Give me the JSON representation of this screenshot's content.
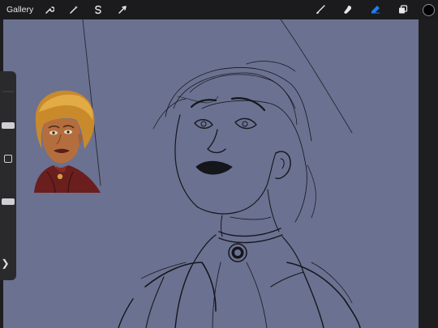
{
  "topbar": {
    "gallery_label": "Gallery",
    "left_tools": [
      {
        "name": "actions",
        "icon": "wrench-icon"
      },
      {
        "name": "adjustments",
        "icon": "magic-wand-icon"
      },
      {
        "name": "selection",
        "icon": "selection-s-icon"
      },
      {
        "name": "transform",
        "icon": "arrow-cursor-icon"
      }
    ],
    "right_tools": [
      {
        "name": "brush",
        "icon": "brush-icon",
        "active": false
      },
      {
        "name": "smudge",
        "icon": "smudge-icon",
        "active": false
      },
      {
        "name": "eraser",
        "icon": "eraser-icon",
        "active": true
      },
      {
        "name": "layers",
        "icon": "layers-icon",
        "active": false
      }
    ],
    "current_color": "#000000"
  },
  "sidebar": {
    "brush_size_level": 0.37,
    "opacity_level": 0.62,
    "handle_glyph": "❯"
  },
  "colors": {
    "canvas_background": "#6b7190",
    "chrome": "#1b1b1d",
    "active_tool": "#1e7cf2",
    "sketch_stroke": "#15161c"
  }
}
